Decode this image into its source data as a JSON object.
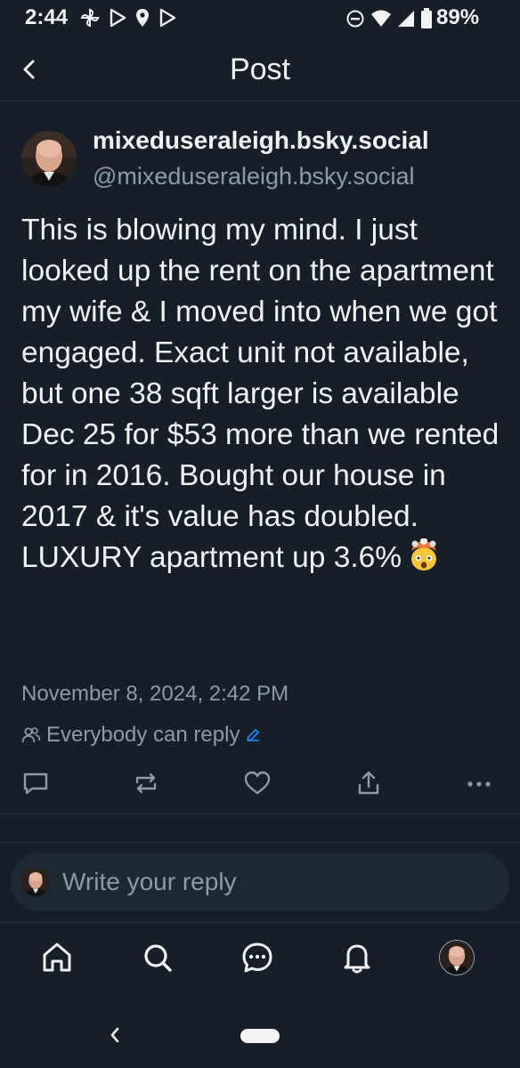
{
  "status_bar": {
    "time": "2:44",
    "battery_percent": "89%",
    "left_icons": [
      "pinwheel-icon",
      "play-icon",
      "location-icon",
      "play-outline-icon"
    ],
    "right_icons": [
      "do-not-disturb-icon",
      "wifi-icon",
      "cell-signal-icon",
      "battery-icon"
    ]
  },
  "header": {
    "title": "Post"
  },
  "post": {
    "author": {
      "display_name": "mixeduseraleigh.bsky.social",
      "handle": "@mixeduseraleigh.bsky.social"
    },
    "text": "This is blowing my mind. I just looked up the rent on the apartment my wife & I moved into when we got engaged. Exact unit not available, but one 38 sqft larger is available Dec 25 for $53 more than we rented for in 2016. Bought our house in 2017 & it's value has doubled. LUXURY apartment up 3.6%",
    "emoji": "exploding-head-emoji",
    "timestamp": "November 8, 2024, 2:42 PM",
    "reply_setting": "Everybody can reply"
  },
  "actions": [
    "reply-icon",
    "repost-icon",
    "like-icon",
    "share-icon",
    "more-icon"
  ],
  "reply_box": {
    "placeholder": "Write your reply"
  },
  "bottom_nav": [
    "home-icon",
    "search-icon",
    "chat-icon",
    "notifications-icon",
    "profile-avatar"
  ],
  "colors": {
    "background": "#161e27",
    "text": "#f1f3f5",
    "muted": "#8d9aa8",
    "accent": "#208bfe",
    "input_bg": "#1e2833"
  }
}
